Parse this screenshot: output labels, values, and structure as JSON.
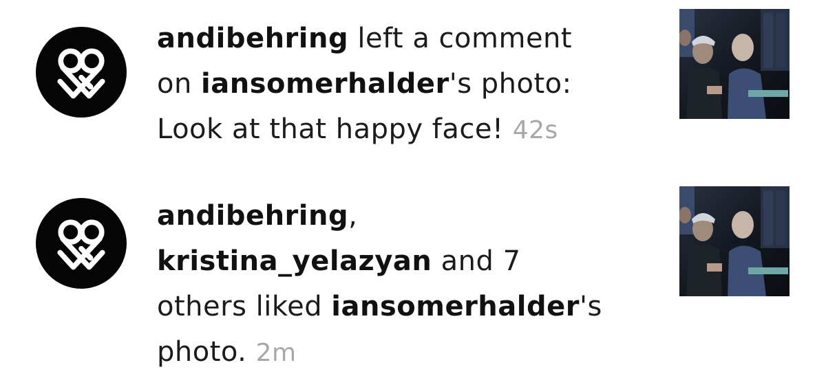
{
  "notifications": [
    {
      "avatar_icon": "ampersand-heart-logo-icon",
      "parts": [
        {
          "user": "andibehring",
          "text": " left a comment"
        },
        {
          "text": "on ",
          "user": "iansomerhalder",
          "text2": "'s photo:"
        },
        {
          "text": "Look at that happy face! ",
          "time": "42s"
        }
      ]
    },
    {
      "avatar_icon": "ampersand-heart-logo-icon",
      "parts": [
        {
          "user": "andibehring",
          "text": ","
        },
        {
          "user": "kristina_yelazyan",
          "text": " and 7"
        },
        {
          "text": "others liked ",
          "user": "iansomerhalder",
          "text2": "'s"
        },
        {
          "text": "photo. ",
          "time": "2m"
        }
      ]
    }
  ],
  "colors": {
    "username": "#111111",
    "body_text": "#1b1b1b",
    "timestamp": "#a7a7a7",
    "avatar_bg": "#050505"
  }
}
